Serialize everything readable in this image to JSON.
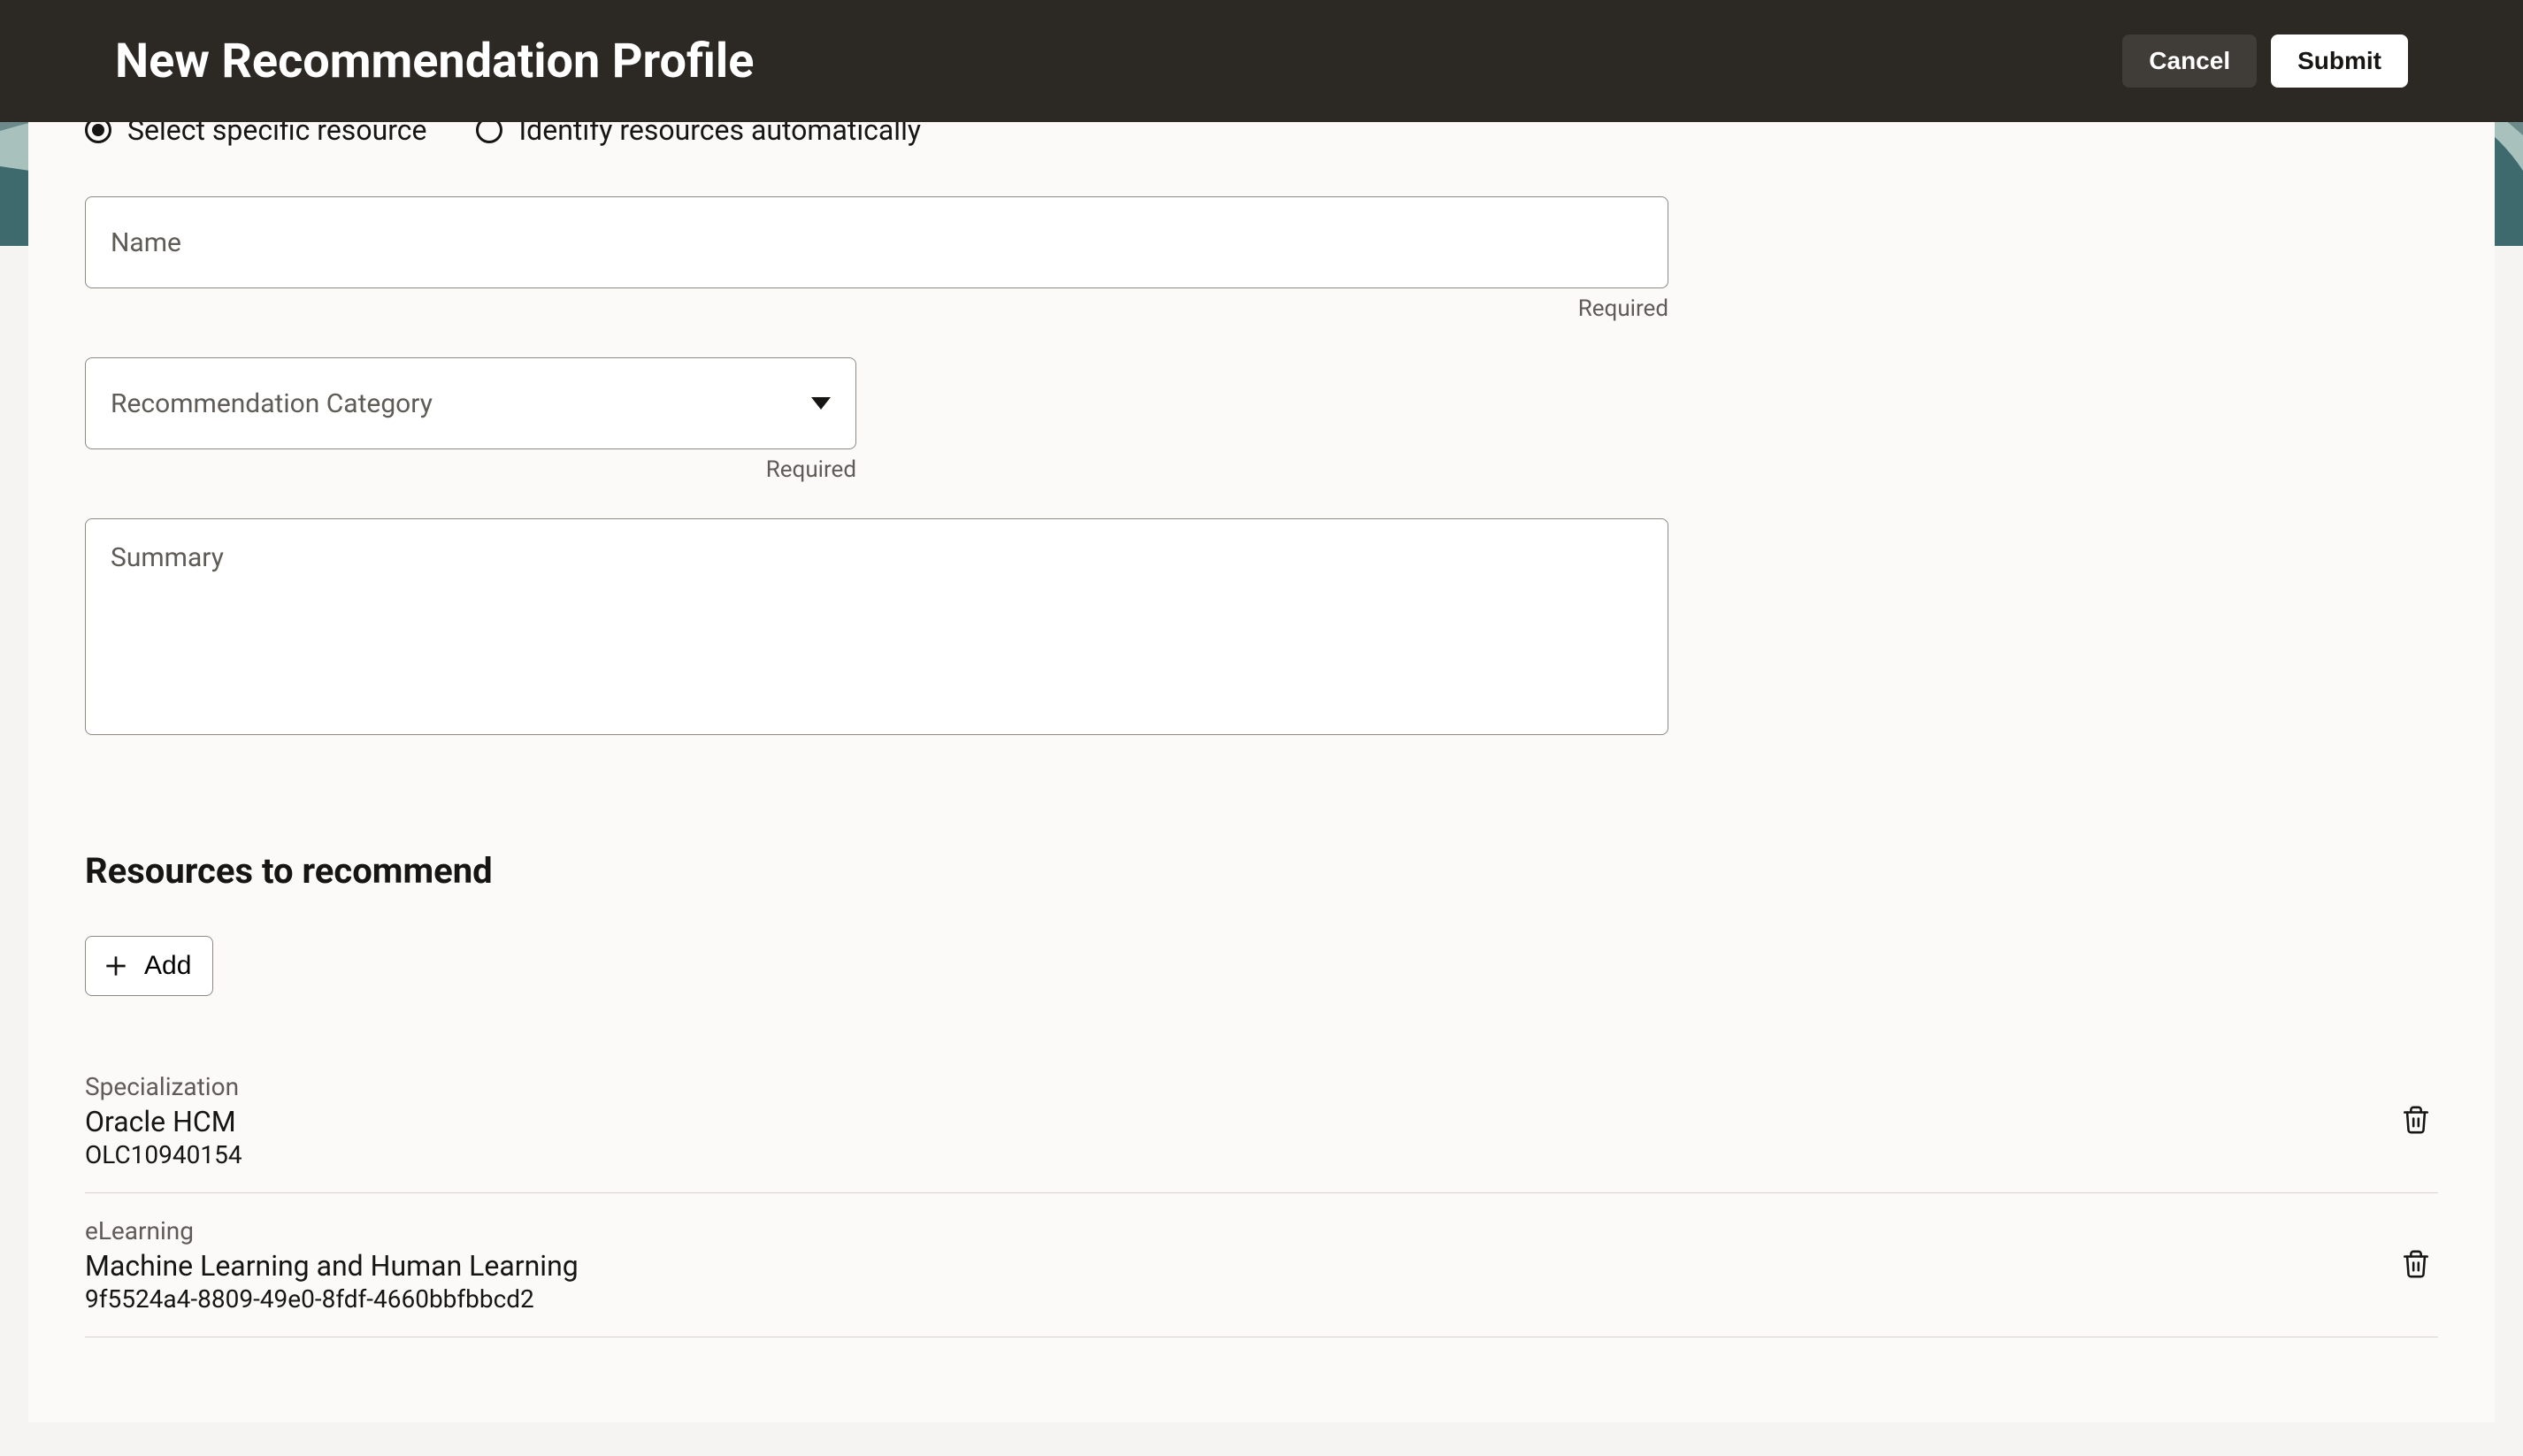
{
  "header": {
    "title": "New Recommendation Profile",
    "cancel": "Cancel",
    "submit": "Submit"
  },
  "radios": {
    "specific": "Select specific resource",
    "auto": "Identify resources automatically"
  },
  "fields": {
    "name_label": "Name",
    "name_required": "Required",
    "category_label": "Recommendation Category",
    "category_required": "Required",
    "summary_label": "Summary"
  },
  "section": {
    "resources_heading": "Resources to recommend",
    "add_label": "Add"
  },
  "resources": [
    {
      "type": "Specialization",
      "title": "Oracle HCM",
      "code": "OLC10940154"
    },
    {
      "type": "eLearning",
      "title": "Machine Learning and Human Learning",
      "code": "9f5524a4-8809-49e0-8fdf-4660bbfbbcd2"
    }
  ]
}
